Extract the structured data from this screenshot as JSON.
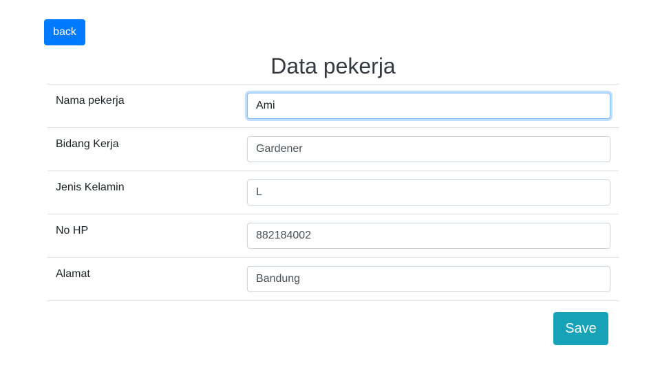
{
  "header": {
    "back_label": "back",
    "title": "Data pekerja"
  },
  "form": {
    "fields": [
      {
        "label": "Nama pekerja",
        "value": "Ami"
      },
      {
        "label": "Bidang Kerja",
        "value": "Gardener"
      },
      {
        "label": "Jenis Kelamin",
        "value": "L"
      },
      {
        "label": "No HP",
        "value": "882184002"
      },
      {
        "label": "Alamat",
        "value": "Bandung"
      }
    ],
    "save_label": "Save"
  },
  "colors": {
    "primary": "#007bff",
    "info": "#17a2b8",
    "border": "#dee2e6",
    "focus": "#80bdff"
  }
}
